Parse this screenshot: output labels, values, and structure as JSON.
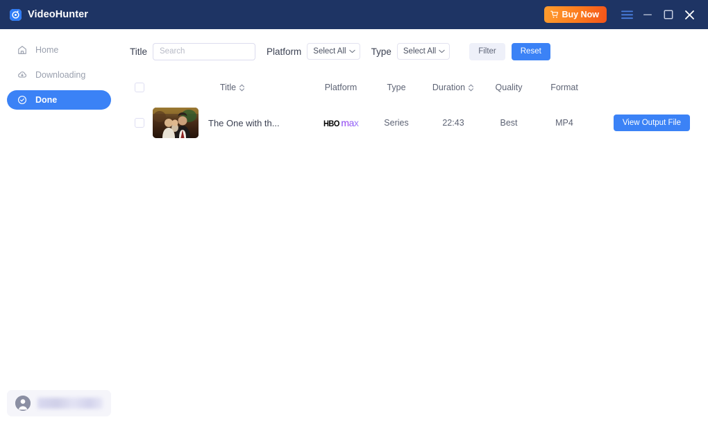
{
  "titlebar": {
    "app_name": "VideoHunter",
    "app_icon": "videohunter-logo-icon",
    "buy_now_label": "Buy Now",
    "cart_icon": "shopping-cart-icon",
    "menu_icon": "hamburger-menu-icon",
    "minimize_icon": "minimize-icon",
    "maximize_icon": "maximize-icon",
    "close_icon": "close-icon",
    "background_color": "#1e3464",
    "accent_color": "#f4541a"
  },
  "sidebar": {
    "items": [
      {
        "label": "Home",
        "icon": "home-icon",
        "active": false
      },
      {
        "label": "Downloading",
        "icon": "download-cloud-icon",
        "active": false
      },
      {
        "label": "Done",
        "icon": "check-circle-icon",
        "active": true
      }
    ],
    "active_color": "#3b82f6",
    "user": {
      "avatar_icon": "user-avatar-icon",
      "name": ""
    }
  },
  "toolbar": {
    "title_label": "Title",
    "search_placeholder": "Search",
    "search_value": "",
    "platform_label": "Platform",
    "platform_value": "Select All",
    "type_label": "Type",
    "type_value": "Select All",
    "filter_label": "Filter",
    "reset_label": "Reset",
    "chevron_icon": "chevron-down-icon"
  },
  "table": {
    "columns": [
      {
        "key": "check",
        "label": "",
        "sortable": false
      },
      {
        "key": "title",
        "label": "Title",
        "sortable": true
      },
      {
        "key": "platform",
        "label": "Platform",
        "sortable": false
      },
      {
        "key": "type",
        "label": "Type",
        "sortable": false
      },
      {
        "key": "duration",
        "label": "Duration",
        "sortable": true
      },
      {
        "key": "quality",
        "label": "Quality",
        "sortable": false
      },
      {
        "key": "format",
        "label": "Format",
        "sortable": false
      }
    ],
    "sort_icon": "sort-updown-icon",
    "rows": [
      {
        "selected": false,
        "thumbnail": "video-thumbnail",
        "title": "The One with th...",
        "platform": "HBO max",
        "platform_logo": {
          "primary": "HBO",
          "secondary": "max"
        },
        "type": "Series",
        "duration": "22:43",
        "quality": "Best",
        "format": "MP4",
        "action_label": "View Output File"
      }
    ]
  }
}
